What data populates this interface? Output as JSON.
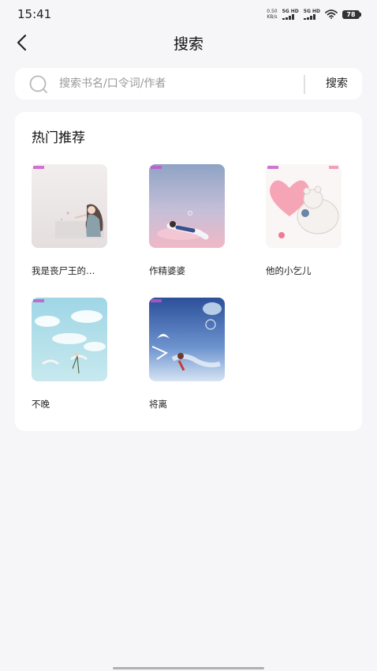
{
  "status_bar": {
    "time": "15:41",
    "net_speed_value": "0.50",
    "net_speed_unit": "KB/s",
    "sim1_label": "5G HD",
    "sim2_label": "5G HD",
    "battery": "78"
  },
  "header": {
    "title": "搜索"
  },
  "search": {
    "placeholder": "搜索书名/口令词/作者",
    "value": "",
    "button_label": "搜索"
  },
  "hot": {
    "title": "热门推荐",
    "books": [
      {
        "title": "我是丧尸王的…",
        "cover": "girl-sitting-cover"
      },
      {
        "title": "作精婆婆",
        "cover": "boy-floating-cover"
      },
      {
        "title": "他的小乞儿",
        "cover": "bear-heart-cover"
      },
      {
        "title": "不晚",
        "cover": "sky-cranes-cover"
      },
      {
        "title": "将离",
        "cover": "blue-fantasy-cover"
      }
    ]
  },
  "icons": {
    "back": "chevron-left-icon",
    "search": "search-icon"
  }
}
